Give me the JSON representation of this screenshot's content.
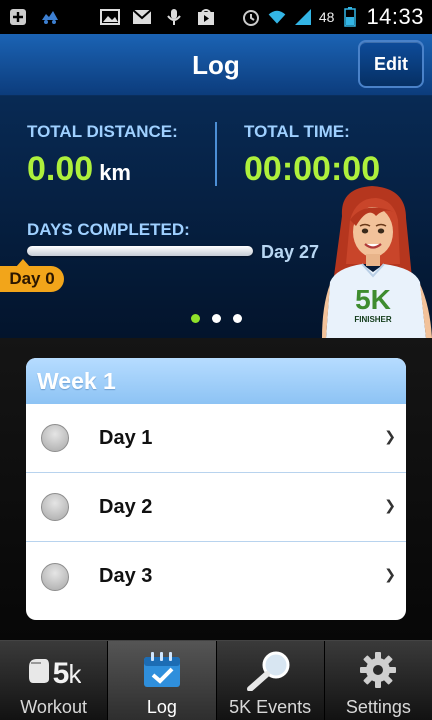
{
  "status_bar": {
    "battery_percent": "48",
    "time": "14:33"
  },
  "header": {
    "title": "Log",
    "edit_label": "Edit"
  },
  "stats": {
    "total_distance_label": "TOTAL DISTANCE:",
    "total_distance_value": "0.00",
    "distance_unit": "km",
    "total_time_label": "TOTAL TIME:",
    "total_time_value": "00:00:00",
    "days_completed_label": "DAYS COMPLETED:",
    "day_end": "Day 27",
    "day_current": "Day 0",
    "progress": 0,
    "page_index": 1,
    "page_count": 3
  },
  "shirt": {
    "brand": "5K",
    "caption": "FINISHER"
  },
  "week": {
    "title": "Week 1",
    "days": [
      {
        "label": "Day 1"
      },
      {
        "label": "Day 2"
      },
      {
        "label": "Day 3"
      }
    ]
  },
  "tabs": [
    {
      "label": "Workout",
      "icon": "runner-5k-icon"
    },
    {
      "label": "Log",
      "icon": "calendar-check-icon",
      "active": true
    },
    {
      "label": "5K Events",
      "icon": "magnifier-icon"
    },
    {
      "label": "Settings",
      "icon": "gear-icon"
    }
  ],
  "colors": {
    "accent_green": "#aef03c",
    "header_blue": "#1b63b4",
    "badge_orange": "#f2a51a",
    "week_header": "#8dc3f4"
  }
}
